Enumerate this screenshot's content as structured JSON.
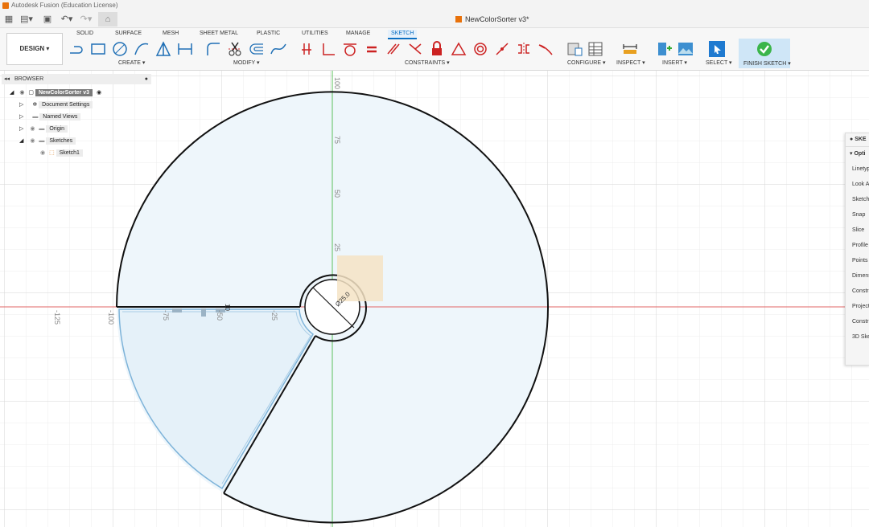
{
  "window": {
    "title": "Autodesk Fusion (Education License)"
  },
  "document": {
    "name": "NewColorSorter v3*"
  },
  "workspace": {
    "label": "DESIGN"
  },
  "tabs": [
    "SOLID",
    "SURFACE",
    "MESH",
    "SHEET METAL",
    "PLASTIC",
    "UTILITIES",
    "MANAGE",
    "SKETCH"
  ],
  "groups": {
    "create": "CREATE",
    "modify": "MODIFY",
    "constraints": "CONSTRAINTS",
    "configure": "CONFIGURE",
    "inspect": "INSPECT",
    "insert": "INSERT",
    "select": "SELECT",
    "finish": "FINISH SKETCH"
  },
  "browser": {
    "title": "BROWSER",
    "items": [
      {
        "label": "NewColorSorter v3"
      },
      {
        "label": "Document Settings"
      },
      {
        "label": "Named Views"
      },
      {
        "label": "Origin"
      },
      {
        "label": "Sketches"
      },
      {
        "label": "Sketch1"
      }
    ]
  },
  "palette": {
    "title": "SKE",
    "section": "Opti",
    "rows": [
      "Linetyp",
      "Look A",
      "Sketch",
      "Snap",
      "Slice",
      "Profile",
      "Points",
      "Dimens",
      "Constra",
      "Project",
      "Constr",
      "3D Ske"
    ]
  },
  "canvas": {
    "ruler_v": [
      "100",
      "75",
      "50",
      "25"
    ],
    "ruler_h": [
      "-125",
      "-100",
      "-75",
      "-50",
      "-25"
    ],
    "dim_small": "Ø25.0",
    "dim_tag": "10",
    "colors": {
      "axis_x": "#e05050",
      "axis_y": "#5cc05c",
      "profile_fill": "#eaf4fb",
      "profile_edge": "#7db3d9",
      "grid": "#e6e6e6",
      "grid_major": "#d4d4d4",
      "line": "#000000"
    }
  }
}
